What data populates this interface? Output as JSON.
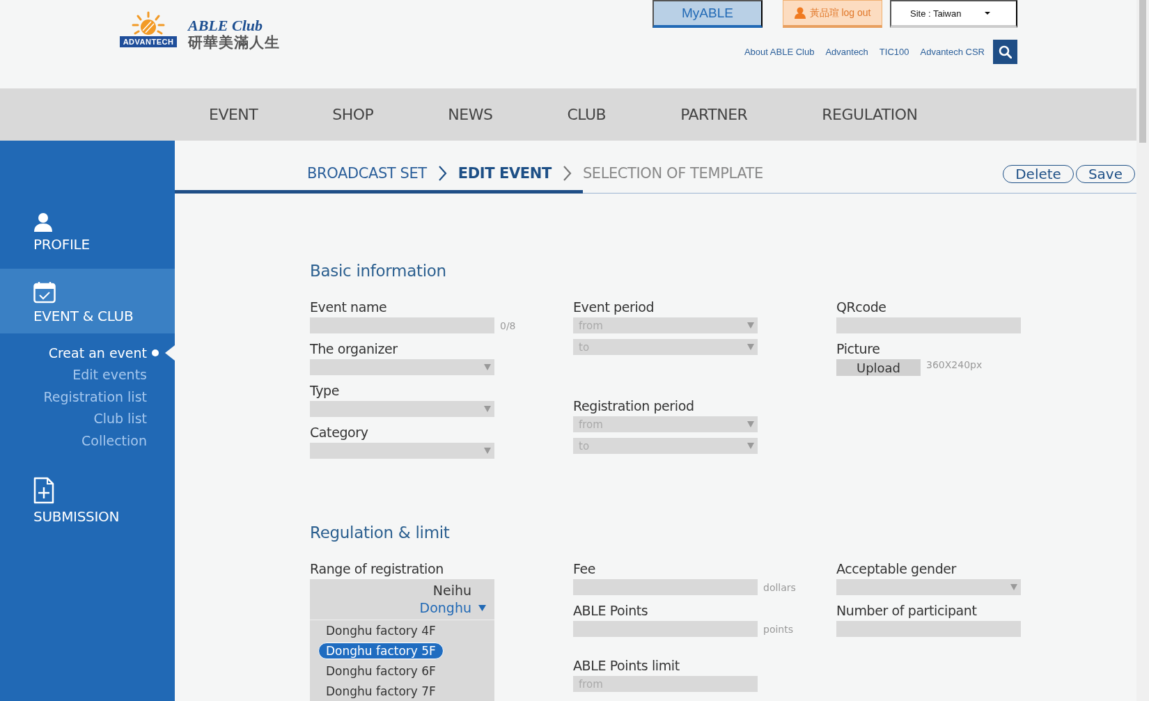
{
  "header": {
    "logo": {
      "badge": "ADVANTECH",
      "brand": "ABLE Club",
      "tagline": "研華美滿人生"
    },
    "top_buttons": [
      {
        "kind": "myable",
        "label": "MyABLE"
      },
      {
        "kind": "user",
        "label": "黃品瑄 log out"
      },
      {
        "kind": "site",
        "label": "Site : Taiwan"
      }
    ],
    "links": [
      "About ABLE Club",
      "Advantech",
      "TIC100",
      "Advantech CSR"
    ]
  },
  "nav": [
    "EVENT",
    "SHOP",
    "NEWS",
    "CLUB",
    "PARTNER",
    "REGULATION"
  ],
  "sidebar": {
    "sections": [
      {
        "label": "PROFILE",
        "kind": "person",
        "selected": false
      },
      {
        "label": "EVENT & CLUB",
        "kind": "calendar",
        "selected": true,
        "children": [
          {
            "label": "Creat an event",
            "selected": true
          },
          {
            "label": "Edit  events",
            "selected": false
          },
          {
            "label": "Registration list",
            "selected": false
          },
          {
            "label": "Club list",
            "selected": false
          },
          {
            "label": "Collection",
            "selected": false
          }
        ]
      },
      {
        "label": "SUBMISSION",
        "kind": "document",
        "selected": false
      }
    ]
  },
  "breadcrumb": [
    {
      "label": "BROADCAST SET",
      "done": true,
      "selected": false
    },
    {
      "label": "EDIT EVENT",
      "done": false,
      "selected": true
    },
    {
      "label": "SELECTION OF TEMPLATE",
      "done": false,
      "selected": false
    }
  ],
  "actions": [
    "Delete",
    "Save"
  ],
  "sections": [
    {
      "title": "Basic information",
      "columns": [
        [
          {
            "label": "Event name",
            "kind": "text",
            "suffix": "0/8"
          },
          {
            "label": "The organizer",
            "kind": "select"
          },
          {
            "label": "Type",
            "kind": "select"
          },
          {
            "label": "Category",
            "kind": "select"
          }
        ],
        [
          {
            "label": "Event period",
            "kind": "range",
            "inputs": [
              {
                "placeholder": "from",
                "kind": "select"
              },
              {
                "placeholder": "to",
                "kind": "select"
              }
            ]
          },
          {
            "label": "Registration period",
            "kind": "range",
            "inputs": [
              {
                "placeholder": "from",
                "kind": "select"
              },
              {
                "placeholder": "to",
                "kind": "select"
              }
            ]
          }
        ],
        [
          {
            "label": "QRcode",
            "kind": "text"
          },
          {
            "label": "Picture",
            "kind": "upload",
            "button": "Upload",
            "suffix": "360X240px"
          }
        ]
      ]
    },
    {
      "title": "Regulation & limit",
      "columns": [
        [
          {
            "label": "Range of registration",
            "kind": "list",
            "regions": [
              {
                "label": "Neihu",
                "selected": false
              },
              {
                "label": "Donghu",
                "selected": true
              }
            ],
            "options": [
              {
                "label": "Donghu factory 4F",
                "selected": false
              },
              {
                "label": "Donghu factory 5F",
                "selected": true
              },
              {
                "label": "Donghu factory 6F",
                "selected": false
              },
              {
                "label": "Donghu factory 7F",
                "selected": false
              }
            ]
          }
        ],
        [
          {
            "label": "Fee",
            "kind": "text",
            "suffix": "dollars"
          },
          {
            "label": "ABLE Points",
            "kind": "text",
            "suffix": "points"
          },
          {
            "label": "ABLE Points limit",
            "kind": "range",
            "inputs": [
              {
                "placeholder": "from",
                "kind": "text"
              }
            ]
          }
        ],
        [
          {
            "label": "Acceptable gender",
            "kind": "select"
          },
          {
            "label": "Number of participant",
            "kind": "text"
          }
        ]
      ]
    }
  ]
}
